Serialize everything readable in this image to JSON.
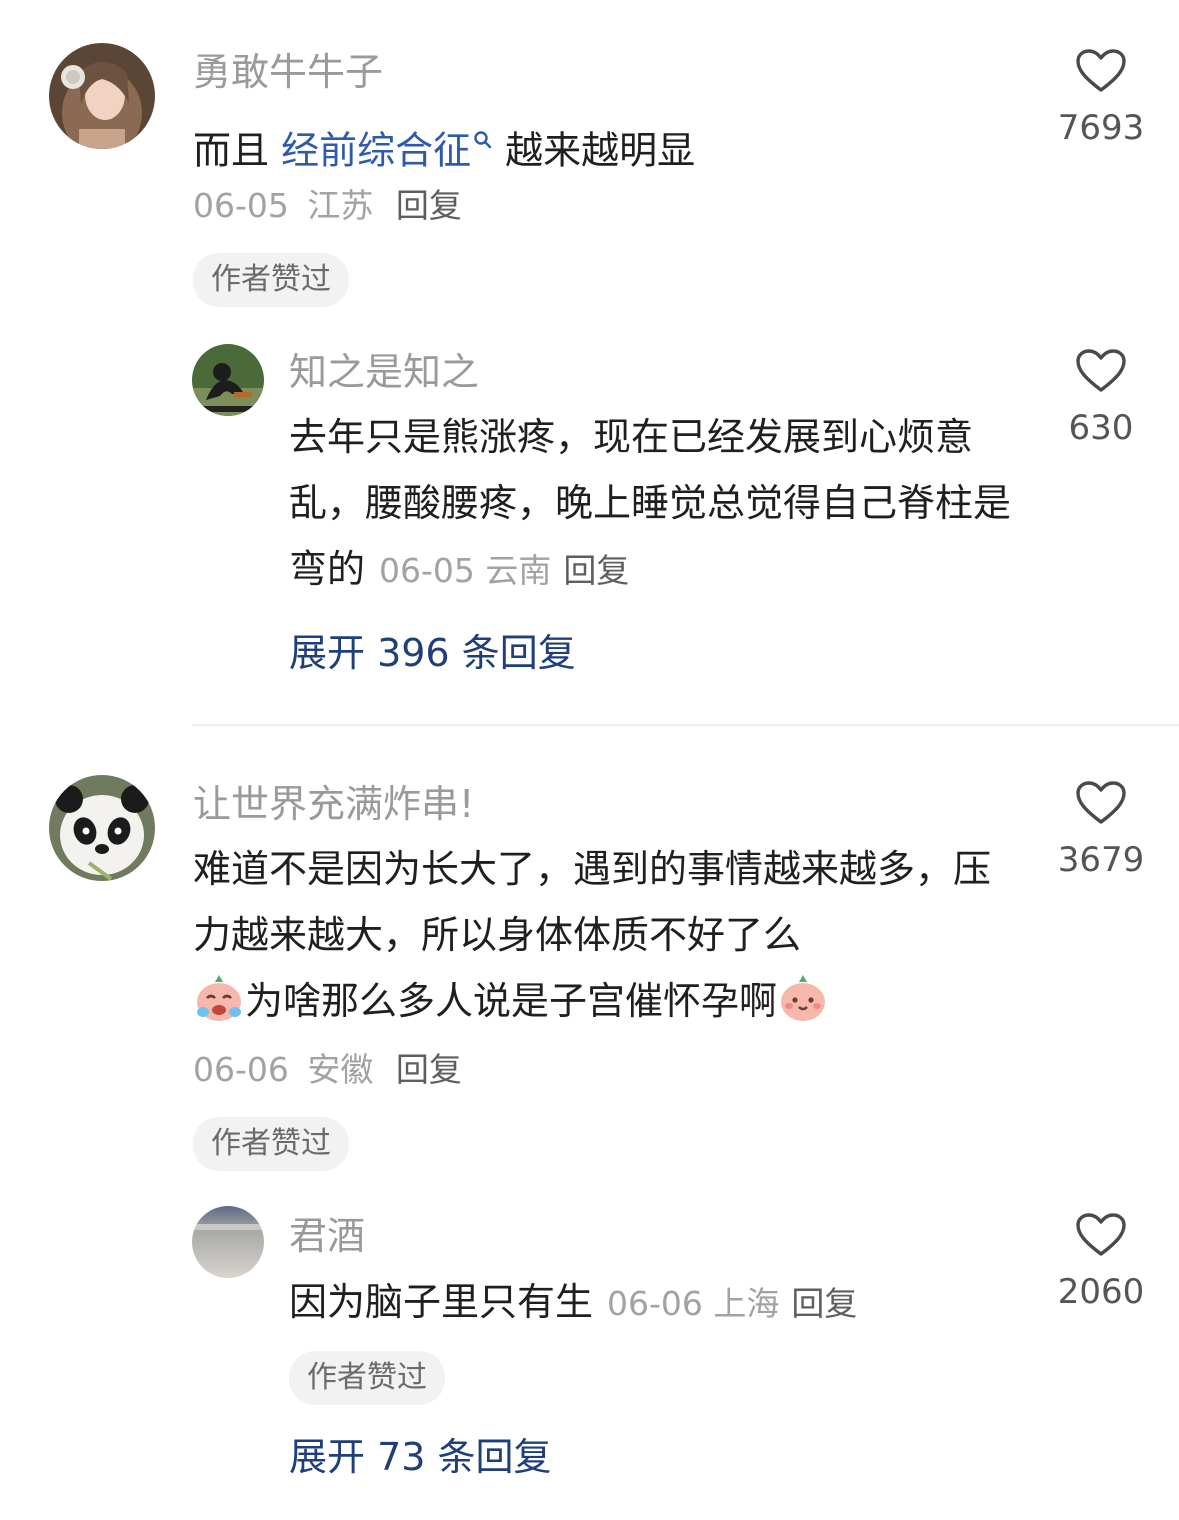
{
  "comments": [
    {
      "username": "勇敢牛牛子",
      "text_before": "而且 ",
      "keyword": "经前综合征",
      "text_after": "越来越明显",
      "date": "06-05",
      "location": "江苏",
      "reply_label": "回复",
      "badge": "作者赞过",
      "like_count": "7693",
      "avatar_icon": "avatar-woman-headphones",
      "replies": [
        {
          "username": "知之是知之",
          "text": "去年只是熊涨疼，现在已经发展到心烦意乱，腰酸腰疼，晚上睡觉总觉得自己脊柱是弯的",
          "date": "06-05",
          "location": "云南",
          "reply_label": "回复",
          "like_count": "630",
          "avatar_icon": "avatar-figure-dark-green"
        }
      ],
      "expand_label": "展开 396 条回复"
    },
    {
      "username": "让世界充满炸串!",
      "text_line1": "难道不是因为长大了，遇到的事情越来越多，压力越来越大，所以身体体质不好了么",
      "text_line2": "为啥那么多人说是子宫催怀孕啊",
      "emoji_before": "crying-peach-emoji",
      "emoji_after": "blushing-peach-emoji",
      "date": "06-06",
      "location": "安徽",
      "reply_label": "回复",
      "badge": "作者赞过",
      "like_count": "3679",
      "avatar_icon": "avatar-panda",
      "replies": [
        {
          "username": "君酒",
          "text": "因为脑子里只有生",
          "date": "06-06",
          "location": "上海",
          "reply_label": "回复",
          "badge": "作者赞过",
          "like_count": "2060",
          "avatar_icon": "avatar-blurry-gray"
        }
      ],
      "expand_label": "展开 73 条回复"
    }
  ],
  "colors": {
    "keyword": "#2e5aa8",
    "expand_link": "#1f3f7a",
    "meta": "#a2a2a2",
    "badge_bg": "#f2f2f2"
  }
}
